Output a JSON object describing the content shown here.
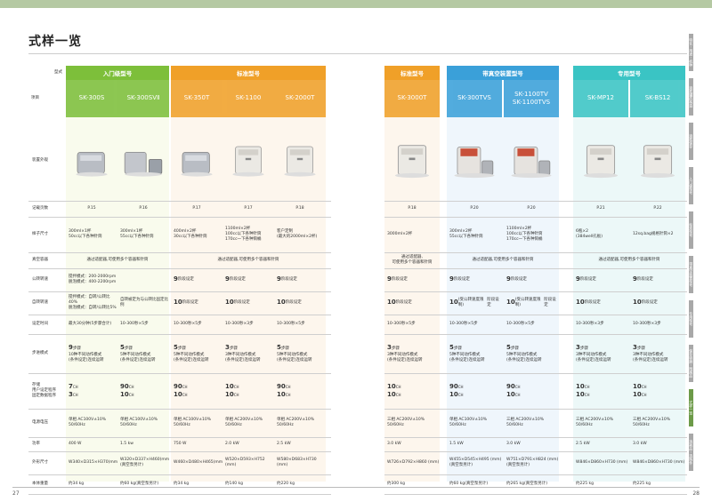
{
  "title": "式样一览",
  "page_left": "27",
  "page_right": "28",
  "corner": {
    "top": "型式",
    "bottom": "项目"
  },
  "tabs": [
    {
      "label": "特长・用途・机种",
      "active": false
    },
    {
      "label": "液氮罐的构造",
      "active": false
    },
    {
      "label": "液氮保存",
      "active": false
    },
    {
      "label": "入门级型号",
      "active": false
    },
    {
      "label": "标准型号",
      "active": false
    },
    {
      "label": "带真空装置型号",
      "active": false
    },
    {
      "label": "专用型号",
      "active": false
    },
    {
      "label": "保存容器・附属品",
      "active": false
    },
    {
      "label": "式样一览",
      "active": true
    },
    {
      "label": "消耗品・选购件",
      "active": false
    }
  ],
  "left_groups": [
    {
      "label": "入门级型号",
      "color": "#7dbf3a",
      "light": "#f4f7df"
    },
    {
      "label": "标准型号",
      "color": "#f0a028",
      "light": "#fbeede"
    }
  ],
  "right_groups": [
    {
      "label": "标准型号",
      "color": "#f0a028",
      "light": "#fbeede"
    },
    {
      "label": "带真空装置型号",
      "color": "#3aa0d9",
      "light": "#e1eff9"
    },
    {
      "label": "专用型号",
      "color": "#3ac4c4",
      "light": "#ddf3f2"
    }
  ],
  "row_labels": {
    "photo": "装置外观",
    "page": "记载页数",
    "sample": "样子尺寸",
    "vessel": "真空容器",
    "speed": "公转转速",
    "rotation": "自转转速",
    "time": "设定时间",
    "steps": "步进模式",
    "memory": "存储\n用户设定程序\n固定数据程序",
    "voltage": "电源电压",
    "power": "功率",
    "size": "外形尺寸",
    "weight": "本体重量"
  },
  "left_models": [
    {
      "name": "SK-300S",
      "page": "P.15",
      "sample": "300ml×1杯\n50cc以下各种针筒",
      "speed": "搅拌模式：200-2000rpm\n脱泡模式：400-2200rpm",
      "rotation": "搅拌模式：自转/公转比40%\n脱泡模式：自转/公转比5%",
      "time": "最大30分钟(5步骤合计)",
      "steps": "9\n10种不同动作模式\n(条件设定)连续运转",
      "memory": "7\n3",
      "voltage": "单相 AC100V±10%\n50/60Hz",
      "power": "400 W",
      "size": "W340×D315×H370(mm)",
      "weight": "约34 kg"
    },
    {
      "name": "SK-300SVⅡ",
      "page": "P.16",
      "sample": "300ml×1杯\n55cc以下各种针筒",
      "speed": "",
      "rotation": "自转被定为与公转比固定比例",
      "time": "10-300秒×5步",
      "steps": "5\n5种不同动作模式\n(条件设定)连续运转",
      "memory": "90\n10",
      "voltage": "单相 AC100V±10%\n50/60Hz",
      "power": "1.5 kw",
      "size": "W320×D337×H460(mm)\n(真空泵另计)",
      "weight": "约60 kg(真空泵另计)"
    },
    {
      "name": "SK-350T",
      "page": "P.17",
      "sample": "400ml×2杯\n30cc以下各种针筒",
      "speed": "9",
      "rotation": "10",
      "time": "10-300秒×5步",
      "steps": "5\n5种不同动作模式\n(条件设定)连续运转",
      "memory": "90\n10",
      "voltage": "单相 AC100V±10%\n50/60Hz",
      "power": "750 W",
      "size": "W460×D480×H465(mm)",
      "weight": "约34 kg"
    },
    {
      "name": "SK-1100",
      "page": "P.17",
      "sample": "1100ml×2杯\n100cc以下各种针筒\n170cc一下各种筒桶",
      "speed": "9",
      "rotation": "10",
      "time": "10-300秒×3步",
      "steps": "3\n3种不同动作模式\n(条件设定)连续运转",
      "memory": "10\n10",
      "voltage": "单相 AC200V±10%\n50/60Hz",
      "power": "2.0 kW",
      "size": "W520×D593×H752 (mm)",
      "weight": "约140 kg"
    },
    {
      "name": "SK-2000T",
      "page": "P.18",
      "sample": "客户定制\n(最大的2000ml×2杯)",
      "speed": "9",
      "rotation": "10",
      "time": "10-300秒×5步",
      "steps": "5\n5种不同动作模式\n(条件设定)连续运转",
      "memory": "90\n10",
      "voltage": "单相 AC200V±10%\n50/60Hz",
      "power": "2.5 kW",
      "size": "W580×D683×H730 (mm)",
      "weight": "约220 kg"
    }
  ],
  "left_vessel": [
    "通过适配器,可使用多个容器和针筒",
    "通过适配器,可使用多个容器和针筒"
  ],
  "left_setting_labels": {
    "speed": "阶段设定",
    "rotation": "阶段设定"
  },
  "right_models": [
    {
      "name": "SK-3000T",
      "page": "P.18",
      "sample": "3000ml×2杯",
      "vessel": "通过适配器,\n可使用多个容器和针筒",
      "speed": "9",
      "rotation": "10",
      "time": "10-300秒×5步",
      "steps": "3\n3种不同动作模式\n(条件设定)连续运转",
      "memory": "10\n10",
      "voltage": "三相 AC200V±10%\n50/60Hz",
      "power": "3.0 kW",
      "size": "W726×D792×H860 (mm)",
      "weight": "约300 kg"
    },
    {
      "name": "SK-300TVS",
      "page": "P.20",
      "sample": "300ml×2杯\n55cc以下各种针筒",
      "speed": "9",
      "rotation": "10\n(受公转速度限制)",
      "time": "10-300秒×5步",
      "steps": "5\n5种不同动作模式\n(条件设定)连续运转",
      "memory": "90\n10",
      "voltage": "单相 AC100V±10%\n50/60Hz",
      "power": "1.5 kW",
      "size": "W455×D545×H495 (mm)\n(真空泵另计)",
      "weight": "约60 kg(真空泵另计)"
    },
    {
      "name": "SK-1100TV\nSK-1100TVS",
      "page": "P.20",
      "sample": "1100ml×2杯\n100cc以下各种针筒\n170cc一下各种筒桶",
      "speed": "9",
      "rotation": "10\n(受公转速度限制)",
      "time": "10-300秒×5步",
      "steps": "5\n5种不同动作模式\n(条件设定)连续运转",
      "memory": "90\n10",
      "voltage": "三相 AC200V±10%\n50/60Hz",
      "power": "3.0 kW",
      "size": "W751×D791×H824 (mm)\n(真空泵另计)",
      "weight": "约265 kg(真空泵另计)"
    },
    {
      "name": "SK-MP12",
      "page": "P.21",
      "sample": "6瓶×2\n(384well孔板)",
      "speed": "9",
      "rotation": "10",
      "time": "10-300秒×3步",
      "steps": "3\n3种不同动作模式\n(条件设定)连续运转",
      "memory": "10\n10",
      "voltage": "三相 AC200V±10%\n50/60Hz",
      "power": "2.5 kW",
      "size": "W846×D860×H730 (mm)",
      "weight": "约225 kg"
    },
    {
      "name": "SK-BS12",
      "page": "P.22",
      "sample": "12sq.bag规格针筒×2",
      "speed": "9",
      "rotation": "10",
      "time": "10-300秒×3步",
      "steps": "3\n3种不同动作模式\n(条件设定)连续运转",
      "memory": "10\n10",
      "voltage": "三相 AC200V±10%\n50/60Hz",
      "power": "3.0 kW",
      "size": "W846×D860×H730 (mm)",
      "weight": "约225 kg"
    }
  ],
  "right_vessel_mid": "通过适配器,可使用多个容器和针筒",
  "right_vessel_end": "通过适配器,可使用多个容器和针筒",
  "setting_label": "阶段设定",
  "unit_ch": "CH",
  "step_label": "步骤"
}
